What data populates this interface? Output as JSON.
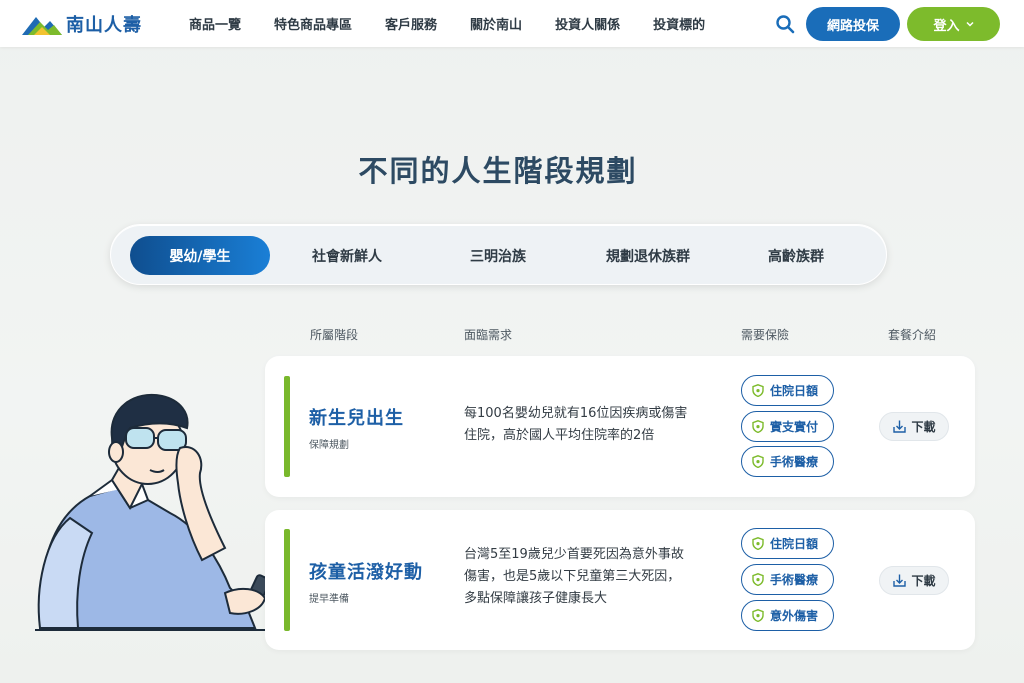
{
  "brand": {
    "name": "南山人壽"
  },
  "nav": [
    {
      "label": "商品一覽"
    },
    {
      "label": "特色商品專區"
    },
    {
      "label": "客戶服務"
    },
    {
      "label": "關於南山"
    },
    {
      "label": "投資人關係"
    },
    {
      "label": "投資標的"
    }
  ],
  "header": {
    "search_icon": "search-icon",
    "online_label": "網路投保",
    "login_label": "登入"
  },
  "page_title": "不同的人生階段規劃",
  "tabs": [
    {
      "label": "嬰幼/學生",
      "active": true
    },
    {
      "label": "社會新鮮人",
      "active": false
    },
    {
      "label": "三明治族",
      "active": false
    },
    {
      "label": "規劃退休族群",
      "active": false
    },
    {
      "label": "高齡族群",
      "active": false
    }
  ],
  "columns": {
    "stage": "所屬階段",
    "needs": "面臨需求",
    "insurance": "需要保險",
    "package": "套餐介紹"
  },
  "cards": [
    {
      "title": "新生兒出生",
      "subtitle": "保障規劃",
      "desc_lines": [
        "每100名嬰幼兒就有16位因疾病或傷害",
        "住院，高於國人平均住院率的2倍"
      ],
      "insurance": [
        "住院日額",
        "實支實付",
        "手術醫療"
      ],
      "download": "下載"
    },
    {
      "title": "孩童活潑好動",
      "subtitle": "提早準備",
      "desc_lines": [
        "台灣5至19歲兒少首要死因為意外事故",
        "傷害，也是5歲以下兒童第三大死因，",
        "多點保障讓孩子健康長大"
      ],
      "insurance": [
        "住院日額",
        "手術醫療",
        "意外傷害"
      ],
      "download": "下載"
    }
  ],
  "colors": {
    "primary_blue": "#1a6db9",
    "brand_green": "#7dbb2c",
    "title_navy": "#2d4a63"
  }
}
